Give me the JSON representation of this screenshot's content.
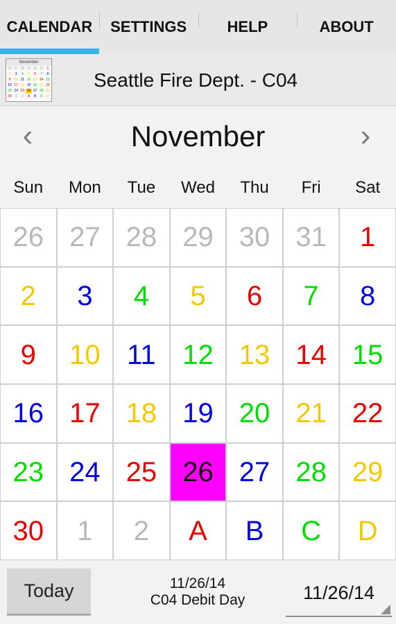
{
  "tabs": [
    {
      "label": "CALENDAR",
      "active": true
    },
    {
      "label": "SETTINGS",
      "active": false
    },
    {
      "label": "HELP",
      "active": false
    },
    {
      "label": "ABOUT",
      "active": false
    }
  ],
  "header": {
    "title": "Seattle Fire Dept. - C04",
    "thumbnail": {
      "icon": "calendar-thumbnail-icon",
      "title": "November",
      "cells": [
        {
          "t": "26",
          "c": "#aaaaaa"
        },
        {
          "t": "27",
          "c": "#aaaaaa"
        },
        {
          "t": "28",
          "c": "#aaaaaa"
        },
        {
          "t": "29",
          "c": "#aaaaaa"
        },
        {
          "t": "30",
          "c": "#aaaaaa"
        },
        {
          "t": "31",
          "c": "#aaaaaa"
        },
        {
          "t": "1",
          "c": "#ff0000"
        },
        {
          "t": "2",
          "c": "#ffd700"
        },
        {
          "t": "3",
          "c": "#0000ff"
        },
        {
          "t": "4",
          "c": "#00cc00"
        },
        {
          "t": "5",
          "c": "#ffd700"
        },
        {
          "t": "6",
          "c": "#ff0000"
        },
        {
          "t": "7",
          "c": "#00cc00"
        },
        {
          "t": "8",
          "c": "#0000ff"
        },
        {
          "t": "9",
          "c": "#ff0000"
        },
        {
          "t": "10",
          "c": "#ffd700"
        },
        {
          "t": "11",
          "c": "#0000ff"
        },
        {
          "t": "12",
          "c": "#00cc00"
        },
        {
          "t": "13",
          "c": "#ffd700"
        },
        {
          "t": "14",
          "c": "#ff0000"
        },
        {
          "t": "15",
          "c": "#00cc00"
        },
        {
          "t": "16",
          "c": "#0000ff"
        },
        {
          "t": "17",
          "c": "#ff0000"
        },
        {
          "t": "18",
          "c": "#ffd700"
        },
        {
          "t": "19",
          "c": "#0000ff"
        },
        {
          "t": "20",
          "c": "#00cc00"
        },
        {
          "t": "21",
          "c": "#ffd700"
        },
        {
          "t": "22",
          "c": "#ff0000"
        },
        {
          "t": "23",
          "c": "#00cc00"
        },
        {
          "t": "24",
          "c": "#0000ff"
        },
        {
          "t": "25",
          "c": "#ff0000"
        },
        {
          "t": "26",
          "c": "#000000",
          "bg": "#ffd700"
        },
        {
          "t": "27",
          "c": "#0000ff"
        },
        {
          "t": "28",
          "c": "#00cc00"
        },
        {
          "t": "29",
          "c": "#ffd700"
        },
        {
          "t": "30",
          "c": "#ff0000"
        },
        {
          "t": "1",
          "c": "#aaaaaa"
        },
        {
          "t": "2",
          "c": "#aaaaaa"
        },
        {
          "t": "A",
          "c": "#ff0000"
        },
        {
          "t": "B",
          "c": "#0000ff"
        },
        {
          "t": "C",
          "c": "#00cc00"
        },
        {
          "t": "D",
          "c": "#ffd700"
        }
      ]
    }
  },
  "nav": {
    "month": "November",
    "prev_glyph": "‹",
    "next_glyph": "›",
    "prev_icon": "chevron-left-icon",
    "next_icon": "chevron-right-icon"
  },
  "weekdays": [
    "Sun",
    "Mon",
    "Tue",
    "Wed",
    "Thu",
    "Fri",
    "Sat"
  ],
  "days": [
    {
      "t": "26",
      "c": "#b8b8b8"
    },
    {
      "t": "27",
      "c": "#b8b8b8"
    },
    {
      "t": "28",
      "c": "#b8b8b8"
    },
    {
      "t": "29",
      "c": "#b8b8b8"
    },
    {
      "t": "30",
      "c": "#b8b8b8"
    },
    {
      "t": "31",
      "c": "#b8b8b8"
    },
    {
      "t": "1",
      "c": "#e60000"
    },
    {
      "t": "2",
      "c": "#f4c800"
    },
    {
      "t": "3",
      "c": "#0000e6"
    },
    {
      "t": "4",
      "c": "#00dd00"
    },
    {
      "t": "5",
      "c": "#f4c800"
    },
    {
      "t": "6",
      "c": "#e60000"
    },
    {
      "t": "7",
      "c": "#00dd00"
    },
    {
      "t": "8",
      "c": "#0000e6"
    },
    {
      "t": "9",
      "c": "#e60000"
    },
    {
      "t": "10",
      "c": "#f4c800"
    },
    {
      "t": "11",
      "c": "#0000e6"
    },
    {
      "t": "12",
      "c": "#00dd00"
    },
    {
      "t": "13",
      "c": "#f4c800"
    },
    {
      "t": "14",
      "c": "#e60000"
    },
    {
      "t": "15",
      "c": "#00dd00"
    },
    {
      "t": "16",
      "c": "#0000e6"
    },
    {
      "t": "17",
      "c": "#e60000"
    },
    {
      "t": "18",
      "c": "#f4c800"
    },
    {
      "t": "19",
      "c": "#0000e6"
    },
    {
      "t": "20",
      "c": "#00dd00"
    },
    {
      "t": "21",
      "c": "#f4c800"
    },
    {
      "t": "22",
      "c": "#e60000"
    },
    {
      "t": "23",
      "c": "#00dd00"
    },
    {
      "t": "24",
      "c": "#0000e6"
    },
    {
      "t": "25",
      "c": "#e60000"
    },
    {
      "t": "26",
      "c": "#111111",
      "bg": "#ff00ff",
      "selected": true
    },
    {
      "t": "27",
      "c": "#0000e6"
    },
    {
      "t": "28",
      "c": "#00dd00"
    },
    {
      "t": "29",
      "c": "#f4c800"
    },
    {
      "t": "30",
      "c": "#e60000"
    },
    {
      "t": "1",
      "c": "#b8b8b8"
    },
    {
      "t": "2",
      "c": "#b8b8b8"
    },
    {
      "t": "A",
      "c": "#e60000"
    },
    {
      "t": "B",
      "c": "#0000e6"
    },
    {
      "t": "C",
      "c": "#00dd00"
    },
    {
      "t": "D",
      "c": "#f4c800"
    }
  ],
  "footer": {
    "today_label": "Today",
    "date_line1": "11/26/14",
    "date_line2": "C04 Debit Day",
    "date_select_value": "11/26/14"
  },
  "colors": {
    "accent": "#33b5e5",
    "selected_day_bg": "#ff00ff"
  }
}
